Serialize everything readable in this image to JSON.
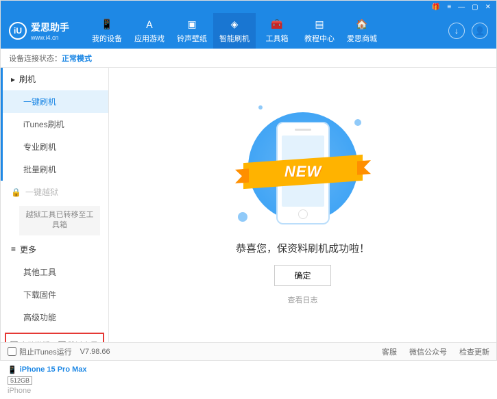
{
  "titlebar": {
    "gift": "🎁",
    "menu": "≡",
    "min": "—",
    "max": "▢",
    "close": "✕"
  },
  "logo": {
    "initial": "iU",
    "name": "爱思助手",
    "url": "www.i4.cn"
  },
  "nav": [
    {
      "label": "我的设备"
    },
    {
      "label": "应用游戏"
    },
    {
      "label": "铃声壁纸"
    },
    {
      "label": "智能刷机"
    },
    {
      "label": "工具箱"
    },
    {
      "label": "教程中心"
    },
    {
      "label": "爱思商城"
    }
  ],
  "status": {
    "label": "设备连接状态：",
    "mode": "正常模式"
  },
  "sidebar": {
    "flash": {
      "head": "刷机",
      "items": [
        "一键刷机",
        "iTunes刷机",
        "专业刷机",
        "批量刷机"
      ]
    },
    "jailbreak": {
      "head": "一键越狱",
      "note": "越狱工具已转移至工具箱"
    },
    "more": {
      "head": "更多",
      "items": [
        "其他工具",
        "下载固件",
        "高级功能"
      ]
    },
    "checks": {
      "auto": "自动激活",
      "skip": "跳过向导"
    },
    "device": {
      "name": "iPhone 15 Pro Max",
      "storage": "512GB",
      "type": "iPhone"
    }
  },
  "main": {
    "ribbon": "NEW",
    "message": "恭喜您，保资料刷机成功啦！",
    "ok": "确定",
    "log": "查看日志"
  },
  "footer": {
    "block": "阻止iTunes运行",
    "version": "V7.98.66",
    "links": [
      "客服",
      "微信公众号",
      "检查更新"
    ]
  }
}
